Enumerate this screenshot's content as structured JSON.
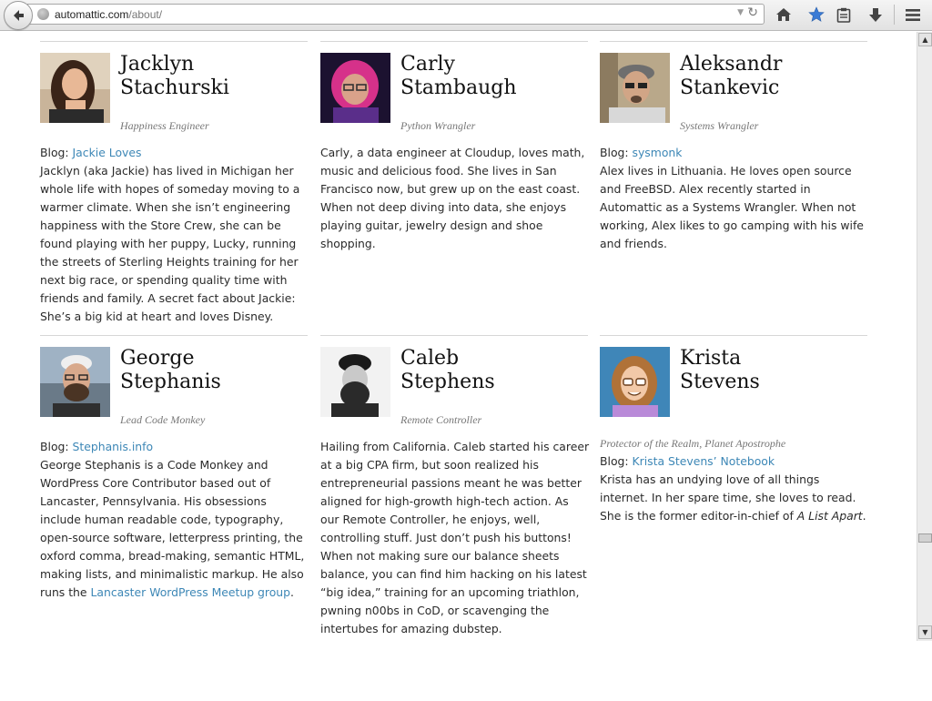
{
  "browser": {
    "url_domain": "automattic.com",
    "url_path": "/about/"
  },
  "people": [
    {
      "name_line1": "Jacklyn",
      "name_line2": "Stachurski",
      "role": "Happiness Engineer",
      "blog_prefix": "Blog: ",
      "blog_link": "Jackie Loves",
      "bio": "Jacklyn (aka Jackie) has lived in Michigan her whole life with hopes of someday moving to a warmer climate. When she isn’t engineering happiness with the Store Crew, she can be found playing with her puppy, Lucky, running the streets of Sterling Heights training for her next big race, or spending quality time with friends and family. A secret fact about Jackie: She’s a big kid at heart and loves Disney."
    },
    {
      "name_line1": "Carly",
      "name_line2": "Stambaugh",
      "role": "Python Wrangler",
      "bio": "Carly, a data engineer at Cloudup, loves math, music and delicious food. She lives in San Francisco now, but grew up on the east coast. When not deep diving into data, she enjoys playing guitar, jewelry design and shoe shopping."
    },
    {
      "name_line1": "Aleksandr",
      "name_line2": "Stankevic",
      "role": "Systems Wrangler",
      "blog_prefix": "Blog: ",
      "blog_link": "sysmonk",
      "bio": "Alex lives in Lithuania. He loves open source and FreeBSD. Alex recently started in Automattic as a Systems Wrangler. When not working, Alex likes to go camping with his wife and friends."
    },
    {
      "name_line1": "George",
      "name_line2": "Stephanis",
      "role": "Lead Code Monkey",
      "blog_prefix": "Blog: ",
      "blog_link": "Stephanis.info",
      "bio": "George Stephanis is a Code Monkey and WordPress Core Contributor based out of Lancaster, Pennsylvania. His obsessions include human readable code, typography, open-source software, letterpress printing, the oxford comma, bread-making, semantic HTML, making lists, and minimalistic markup. He also runs the ",
      "bio_link": "Lancaster WordPress Meetup group",
      "bio_end": "."
    },
    {
      "name_line1": "Caleb",
      "name_line2": "Stephens",
      "role": "Remote Controller",
      "bio": "Hailing from California.  Caleb started his career at a big CPA firm, but soon realized his entrepreneurial passions meant he was better aligned for high-growth high-tech action.  As our Remote Controller,  he enjoys, well, controlling stuff.  Just don’t push his buttons! When not making sure our balance sheets balance, you can find him hacking on his latest “big idea,” training for an upcoming triathlon, pwning n00bs in CoD, or scavenging the intertubes for amazing dubstep."
    },
    {
      "name_line1": "Krista",
      "name_line2": "Stevens",
      "role": "Protector of the Realm, Planet Apostrophe",
      "blog_prefix": "Blog: ",
      "blog_link": "Krista Stevens’ Notebook",
      "bio": "Krista has an undying love of all things internet. In her spare time, she loves to read. She is the former editor-in-chief of ",
      "bio_em": "A List Apart",
      "bio_end": "."
    }
  ],
  "colors": {
    "link": "#3d87b6",
    "name": "#111111",
    "role": "#777777",
    "body": "#2a2a2a",
    "rule": "#d6d6d6"
  },
  "icons": [
    "back-arrow-icon",
    "globe-icon",
    "dropdown-arrow-icon",
    "reload-icon",
    "home-icon",
    "bookmark-star-icon",
    "clipboard-icon",
    "download-icon",
    "menu-icon",
    "scroll-up-icon",
    "scroll-down-icon"
  ]
}
